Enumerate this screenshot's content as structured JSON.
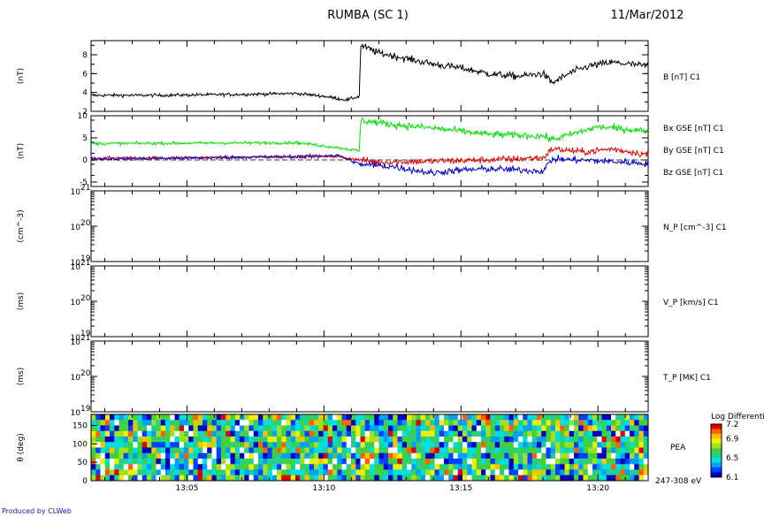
{
  "header": {
    "title": "RUMBA (SC 1)",
    "date": "11/Mar/2012"
  },
  "footer": {
    "credit": "Produced by CLWeb"
  },
  "colors": {
    "bx": "#e00000",
    "by": "#00e000",
    "bz": "#0000c8",
    "b": "#000000"
  },
  "chart_data": [
    {
      "type": "line",
      "panel": "B",
      "ylabel": "(nT)",
      "label": "B [nT] C1",
      "ylim": [
        2,
        9.5
      ],
      "yticks": [
        "2",
        "4",
        "6",
        "8"
      ],
      "x_start": "13:01:30",
      "x_end": "13:21:50",
      "xticks": [
        "13:05",
        "13:10",
        "13:15",
        "13:20"
      ],
      "series": [
        {
          "name": "B [nT] C1",
          "color": "#000000",
          "x": [
            "13:01:30",
            "13:04:00",
            "13:07:00",
            "13:09:00",
            "13:10:00",
            "13:10:50",
            "13:11:18",
            "13:11:20",
            "13:12:00",
            "13:13:00",
            "13:14:00",
            "13:15:00",
            "13:16:00",
            "13:17:00",
            "13:18:00",
            "13:18:20",
            "13:19:00",
            "13:19:40",
            "13:20:30",
            "13:21:50"
          ],
          "y": [
            3.7,
            3.7,
            3.8,
            3.9,
            3.6,
            3.2,
            3.6,
            9.0,
            8.2,
            7.6,
            7.0,
            6.6,
            6.0,
            5.7,
            6.0,
            5.0,
            6.1,
            6.8,
            7.2,
            6.8
          ]
        }
      ]
    },
    {
      "type": "line",
      "panel": "BGSE",
      "ylabel": "(nT)",
      "ylim": [
        -6,
        10
      ],
      "yticks": [
        "-5",
        "0",
        "5",
        "10"
      ],
      "series": [
        {
          "name": "Bx GSE [nT] C1",
          "color": "#e00000",
          "x": [
            "13:01:30",
            "13:05:00",
            "13:09:00",
            "13:10:30",
            "13:11:20",
            "13:12:00",
            "13:14:00",
            "13:16:00",
            "13:18:00",
            "13:18:20",
            "13:19:30",
            "13:20:30",
            "13:21:50"
          ],
          "y": [
            0.4,
            0.5,
            0.7,
            0.8,
            0.0,
            -0.5,
            -0.3,
            0.0,
            0.5,
            2.5,
            1.8,
            2.5,
            1.2
          ]
        },
        {
          "name": "By GSE [nT] C1",
          "color": "#00e000",
          "x": [
            "13:01:30",
            "13:05:00",
            "13:09:00",
            "13:10:30",
            "13:11:18",
            "13:11:20",
            "13:12:30",
            "13:14:00",
            "13:16:00",
            "13:18:00",
            "13:18:20",
            "13:20:00",
            "13:21:50"
          ],
          "y": [
            3.7,
            3.8,
            3.9,
            2.8,
            2.0,
            9.0,
            8.0,
            7.2,
            5.8,
            5.4,
            4.6,
            7.5,
            6.5
          ]
        },
        {
          "name": "Bz GSE [nT] C1",
          "color": "#0000c8",
          "x": [
            "13:01:30",
            "13:05:00",
            "13:09:00",
            "13:10:30",
            "13:11:20",
            "13:12:30",
            "13:14:00",
            "13:14:30",
            "13:16:00",
            "13:18:00",
            "13:18:20",
            "13:20:00",
            "13:21:50"
          ],
          "y": [
            0.2,
            0.4,
            0.8,
            1.0,
            -1.0,
            -1.5,
            -3.0,
            -2.5,
            -2.0,
            -2.5,
            0.2,
            -0.2,
            -0.8
          ]
        }
      ]
    },
    {
      "type": "line",
      "panel": "NP",
      "ylabel": "(cm^-3)",
      "label": "N_P [cm^-3] C1",
      "yticks": [
        "10",
        "10",
        "10"
      ],
      "ysup": [
        "21",
        "20",
        "19"
      ],
      "series": []
    },
    {
      "type": "line",
      "panel": "VP",
      "ylabel": "(ms)",
      "label": "V_P [km/s] C1",
      "yticks": [
        "10",
        "10",
        "10"
      ],
      "ysup": [
        "21",
        "20",
        "19"
      ],
      "series": []
    },
    {
      "type": "line",
      "panel": "TP",
      "ylabel": "(ms)",
      "label": "T_P [MK] C1",
      "yticks": [
        "10",
        "10",
        "10"
      ],
      "ysup": [
        "21",
        "20",
        "19"
      ],
      "series": []
    },
    {
      "type": "heatmap",
      "panel": "PEA",
      "ylabel": "θ (deg)",
      "label": "PEA",
      "sublabel": "247-308 eV",
      "ylim": [
        0,
        180
      ],
      "yticks": [
        "0",
        "50",
        "100",
        "150"
      ],
      "colorbar": {
        "title": "Log Differential",
        "min": 6.1,
        "max": 7.2,
        "ticks": [
          "7.2",
          "6.9",
          "6.5",
          "6.1"
        ]
      }
    }
  ]
}
